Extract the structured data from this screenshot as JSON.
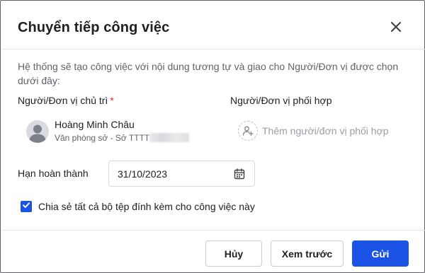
{
  "dialog": {
    "title": "Chuyển tiếp công việc",
    "description": "Hệ thống sẽ tạo công việc với nội dung tương tự và giao cho Người/Đơn vị được chọn dưới đây:"
  },
  "assignee_section": {
    "label": "Người/Đơn vị chủ trì",
    "required_mark": "*",
    "person": {
      "name": "Hoàng Minh Châu",
      "department": "Văn phòng sở - Sở TTTT"
    }
  },
  "collaborator_section": {
    "label": "Người/Đơn vị phối hợp",
    "add_label": "Thêm người/đơn vị phối hợp"
  },
  "deadline": {
    "label": "Hạn hoàn thành",
    "value": "31/10/2023"
  },
  "share_attachments": {
    "label": "Chia sẻ tất cả bộ tệp đính kèm cho công việc này",
    "checked": true
  },
  "footer": {
    "cancel_label": "Hủy",
    "preview_label": "Xem trước",
    "send_label": "Gửi"
  },
  "colors": {
    "primary": "#1a53e5",
    "required": "#d93025",
    "muted_text": "#5f6368",
    "placeholder_text": "#9aa0a6"
  },
  "icons": {
    "close": "close-icon",
    "avatar": "user-avatar",
    "add_collaborator": "add-person-icon",
    "calendar": "calendar-icon",
    "checkbox": "checkmark-icon"
  }
}
